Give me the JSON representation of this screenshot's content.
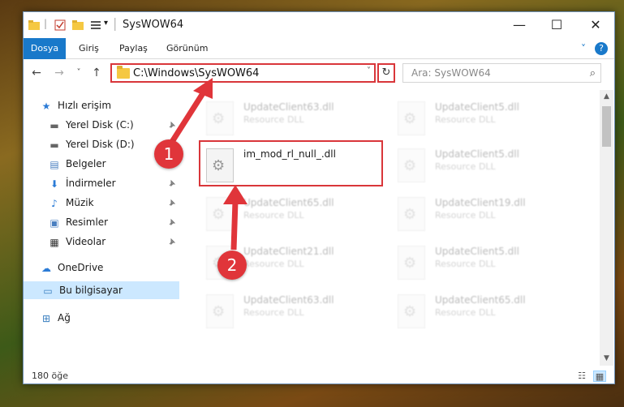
{
  "window": {
    "title": "SysWOW64",
    "minimize_glyph": "—",
    "maximize_glyph": "☐",
    "close_glyph": "✕"
  },
  "quick_access": {
    "separator": "|",
    "dropdown": "▾"
  },
  "ribbon": {
    "tabs": [
      "Dosya",
      "Giriş",
      "Paylaş",
      "Görünüm"
    ],
    "expand_glyph": "˅",
    "help_glyph": "?"
  },
  "nav": {
    "back": "←",
    "forward": "→",
    "recent": "˅",
    "up": "↑",
    "address": "C:\\Windows\\SysWOW64",
    "address_dropdown": "˅",
    "refresh": "↻",
    "search_placeholder": "Ara: SysWOW64",
    "search_icon": "⌕"
  },
  "sidebar": {
    "items": [
      {
        "label": "Hızlı erişim",
        "icon": "★",
        "pinned": false
      },
      {
        "label": "Yerel Disk (C:)",
        "icon": "▬",
        "pinned": true
      },
      {
        "label": "Yerel Disk (D:)",
        "icon": "▬",
        "pinned": true
      },
      {
        "label": "Belgeler",
        "icon": "▤",
        "pinned": true
      },
      {
        "label": "İndirmeler",
        "icon": "⬇",
        "pinned": true
      },
      {
        "label": "Müzik",
        "icon": "♪",
        "pinned": true
      },
      {
        "label": "Resimler",
        "icon": "▣",
        "pinned": true
      },
      {
        "label": "Videolar",
        "icon": "▦",
        "pinned": true
      },
      {
        "label": "OneDrive",
        "icon": "☁",
        "pinned": false
      },
      {
        "label": "Bu bilgisayar",
        "icon": "▭",
        "pinned": false
      },
      {
        "label": "Ağ",
        "icon": "⊞",
        "pinned": false
      }
    ],
    "pin_glyph": "📌"
  },
  "files": {
    "faded": [
      {
        "name": "UpdateClient63.dll",
        "type": "Resource DLL"
      },
      {
        "name": "UpdateClient5.dll",
        "type": "Resource DLL"
      },
      {
        "name": "UpdateClient5.dll",
        "type": "Resource DLL"
      },
      {
        "name": "UpdateClient65.dll",
        "type": "Resource DLL"
      },
      {
        "name": "UpdateClient19.dll",
        "type": "Resource DLL"
      },
      {
        "name": "UpdateClient21.dll",
        "type": "Resource DLL"
      },
      {
        "name": "UpdateClient5.dll",
        "type": "Resource DLL"
      },
      {
        "name": "UpdateClient63.dll",
        "type": "Resource DLL"
      },
      {
        "name": "UpdateClient65.dll",
        "type": "Resource DLL"
      }
    ],
    "highlighted": {
      "name": "im_mod_rl_null_.dll"
    }
  },
  "scrollbar": {
    "up": "▲",
    "down": "▼"
  },
  "status": {
    "count": "180 öğe",
    "details_view": "☷",
    "tiles_view": "▦"
  },
  "annotations": {
    "marker_1": "1",
    "marker_2": "2"
  },
  "colors": {
    "accent": "#1979ca",
    "annotation_red": "#d9363a",
    "selection": "#cce8ff"
  }
}
